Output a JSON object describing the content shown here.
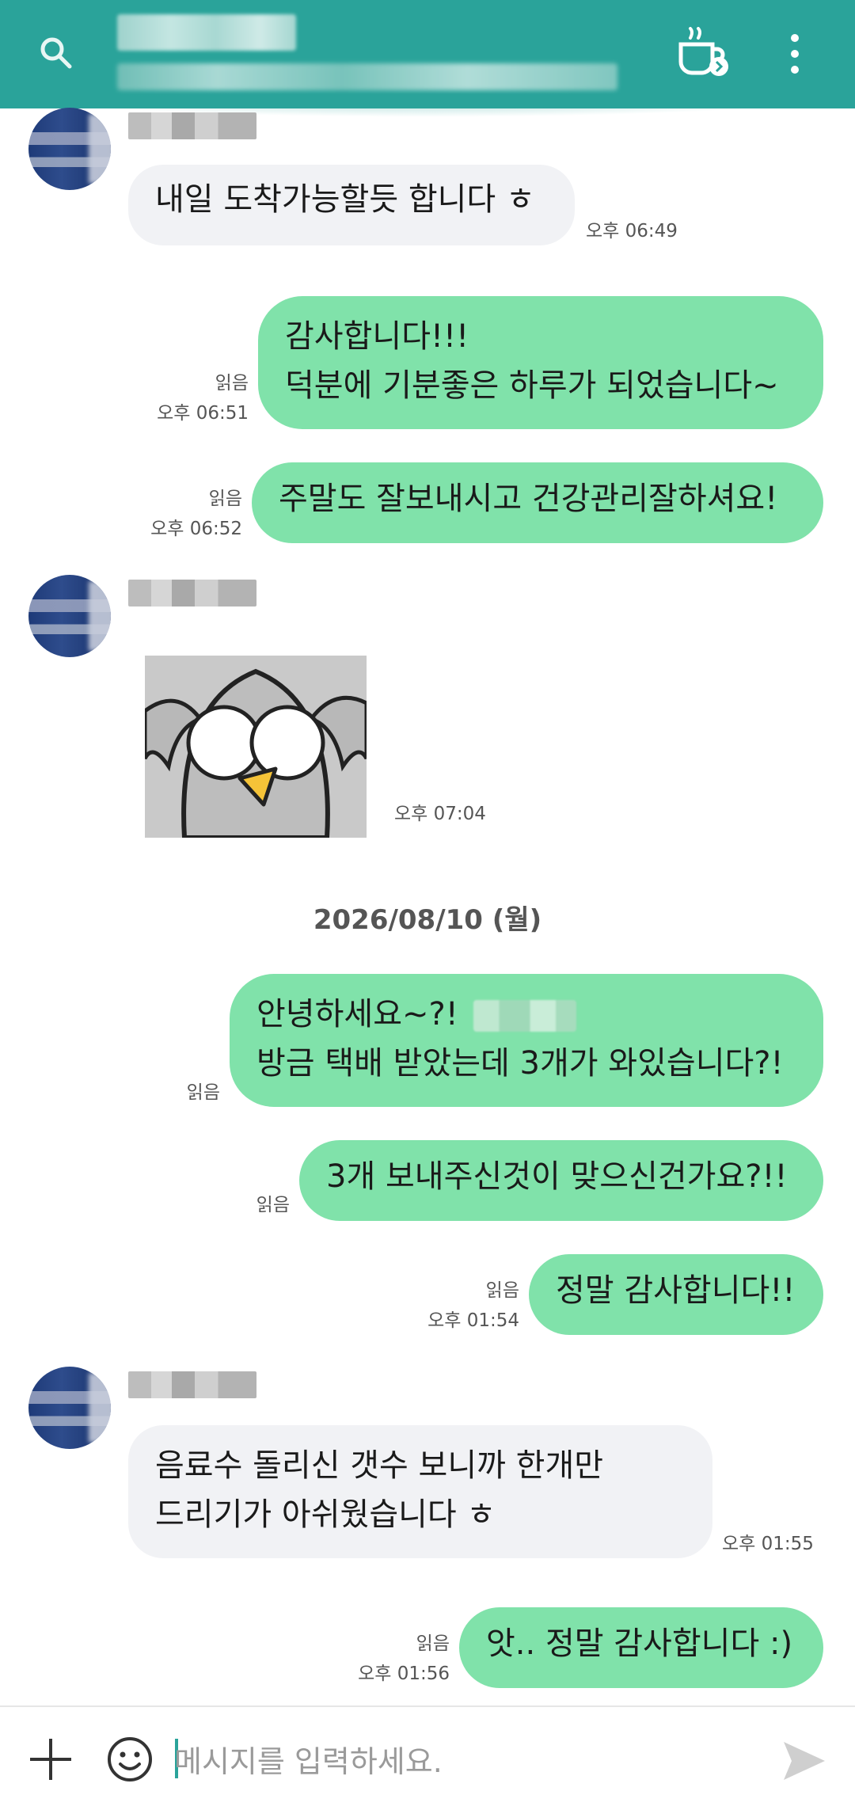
{
  "colors": {
    "header_bg": "#2aa39a",
    "outgoing_bubble": "#80e2aa",
    "incoming_bubble": "#f1f2f5"
  },
  "header": {
    "icons": [
      "search-icon",
      "coffee-cup-icon",
      "more-vert-icon"
    ]
  },
  "messages": {
    "m1": {
      "text": "내일 도착가능할듯 합니다 ㅎ",
      "time": "오후 06:49"
    },
    "m2": {
      "line1": "감사합니다!!!",
      "line2": "덕분에 기분좋은 하루가 되었습니다~",
      "read": "읽음",
      "time": "오후 06:51"
    },
    "m3": {
      "text": "주말도 잘보내시고 건강관리잘하셔요!",
      "read": "읽음",
      "time": "오후 06:52"
    },
    "m4": {
      "time": "오후 07:04"
    },
    "date_separator": "2026/08/10 (월)",
    "m5": {
      "line1a": "안녕하세요~?! ",
      "line2": "방금 택배 받았는데 3개가 와있습니다?!",
      "read": "읽음"
    },
    "m6": {
      "text": "3개 보내주신것이 맞으신건가요?!!",
      "read": "읽음"
    },
    "m7": {
      "text": "정말 감사합니다!!",
      "read": "읽음",
      "time": "오후 01:54"
    },
    "m8": {
      "line1": "음료수 돌리신 갯수 보니까 한개만",
      "line2": "드리기가 아쉬웠습니다 ㅎ",
      "time": "오후 01:55"
    },
    "m9": {
      "text": "앗.. 정말 감사합니다 :)",
      "read": "읽음",
      "time": "오후 01:56"
    }
  },
  "input": {
    "placeholder": "메시지를 입력하세요."
  }
}
